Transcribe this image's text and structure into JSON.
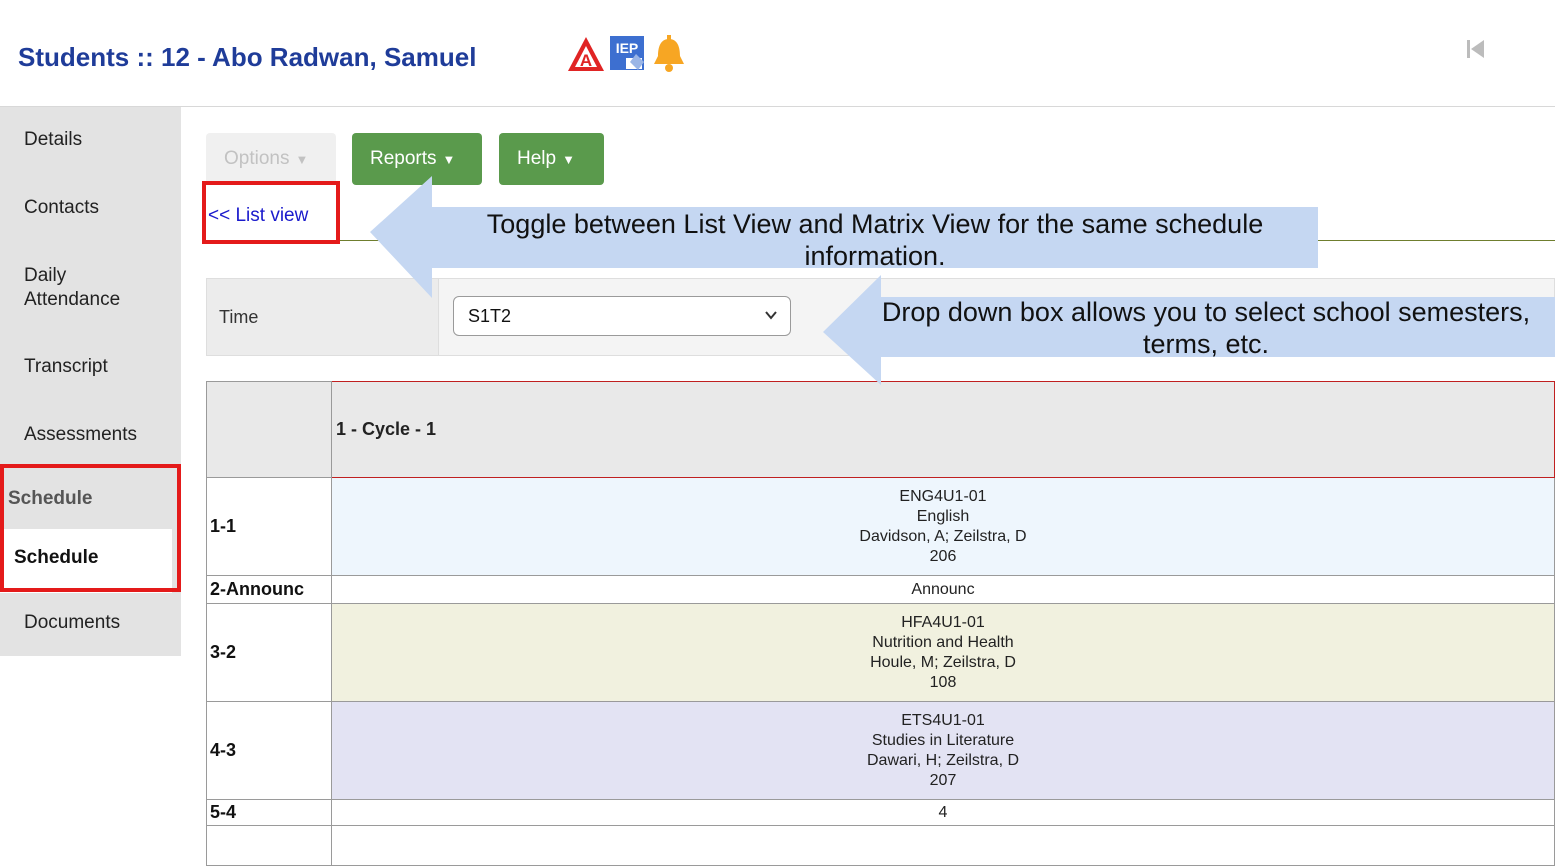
{
  "header": {
    "title": "Students :: 12 - Abo Radwan, Samuel",
    "icons": [
      "alert-triangle-icon",
      "iep-icon",
      "bell-icon"
    ],
    "nav_first_icon": "first-page-icon"
  },
  "sidebar": {
    "items": [
      {
        "label": "Details"
      },
      {
        "label": "Contacts"
      },
      {
        "label": "Daily\nAttendance"
      },
      {
        "label": "Transcript"
      },
      {
        "label": "Assessments"
      },
      {
        "label": "Schedule"
      },
      {
        "label": "Schedule"
      },
      {
        "label": "Documents"
      }
    ]
  },
  "toolbar": {
    "options_label": "Options",
    "reports_label": "Reports",
    "help_label": "Help"
  },
  "list_view_link": "<< List view",
  "filter": {
    "time_label": "Time",
    "time_value": "S1T2"
  },
  "schedule": {
    "cycle_header": "1 - Cycle - 1",
    "rows": [
      {
        "period": "1-1",
        "lines": [
          "ENG4U1-01",
          "English",
          "Davidson, A; Zeilstra, D",
          "206"
        ],
        "color": "#eef6fd"
      },
      {
        "period": "2-Announc",
        "lines": [
          "Announc"
        ],
        "color": "#ffffff"
      },
      {
        "period": "3-2",
        "lines": [
          "HFA4U1-01",
          "Nutrition and Health",
          "Houle, M; Zeilstra, D",
          "108"
        ],
        "color": "#f1f1df"
      },
      {
        "period": "4-3",
        "lines": [
          "ETS4U1-01",
          "Studies in Literature",
          "Dawari, H; Zeilstra, D",
          "207"
        ],
        "color": "#e3e3f3"
      },
      {
        "period": "5-4",
        "lines": [
          "4"
        ],
        "color": "#ffffff"
      }
    ]
  },
  "annotations": {
    "toggle": "Toggle between List View and Matrix View for the same schedule information.",
    "dropdown": "Drop down box allows you to select  school semesters, terms, etc."
  },
  "colors": {
    "title": "#1f3c99",
    "button_green": "#5a9a4c",
    "highlight_red": "#e41a1a",
    "callout_blue": "#c5d7f2"
  }
}
